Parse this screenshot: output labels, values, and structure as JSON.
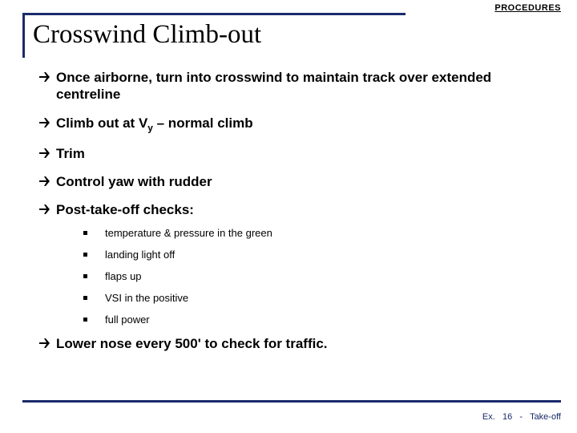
{
  "header": {
    "label": "PROCEDURES"
  },
  "title": "Crosswind Climb-out",
  "bullets": {
    "b1": "Once airborne, turn into crosswind to maintain track over extended centreline",
    "b2_pre": "Climb out at V",
    "b2_sub": "y",
    "b2_post": " – normal climb",
    "b3": "Trim",
    "b4": "Control yaw with rudder",
    "b5": "Post-take-off checks:",
    "b6": "Lower nose every 500' to check for traffic."
  },
  "checks": {
    "c1": "temperature & pressure in the green",
    "c2": "landing light off",
    "c3": "flaps up",
    "c4": "VSI in the positive",
    "c5": "full power"
  },
  "footer": {
    "prefix": "Ex.",
    "num": "16",
    "sep": "-",
    "name": "Take-off"
  }
}
